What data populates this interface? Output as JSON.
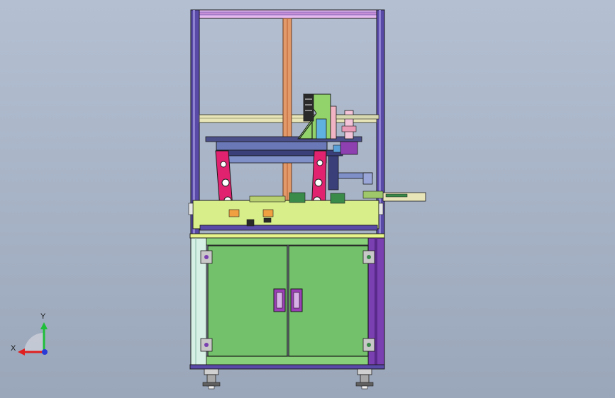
{
  "viewport": {
    "background_top": "#b4c0d2",
    "background_bottom": "#9aa6b9"
  },
  "triad": {
    "x_label": "X",
    "y_label": "Y",
    "x_color": "#e02020",
    "y_color": "#1fbf3a",
    "z_color": "#2a3bd6"
  },
  "colors": {
    "frame_purple": "#5a4aa8",
    "frame_violet": "#7a3fb0",
    "rail_khaki": "#d9d7a8",
    "body_green": "#73c26b",
    "plate_lime": "#d8ee8a",
    "bracket_magenta": "#e0226f",
    "post_orange": "#e39a6a",
    "handle_purple": "#9a3fb5",
    "outline": "#1b1b1b"
  },
  "parts": {
    "left_handle_icon": "door-handle-icon",
    "right_handle_icon": "door-handle-icon",
    "caster_icon": "caster-wheel-icon"
  }
}
